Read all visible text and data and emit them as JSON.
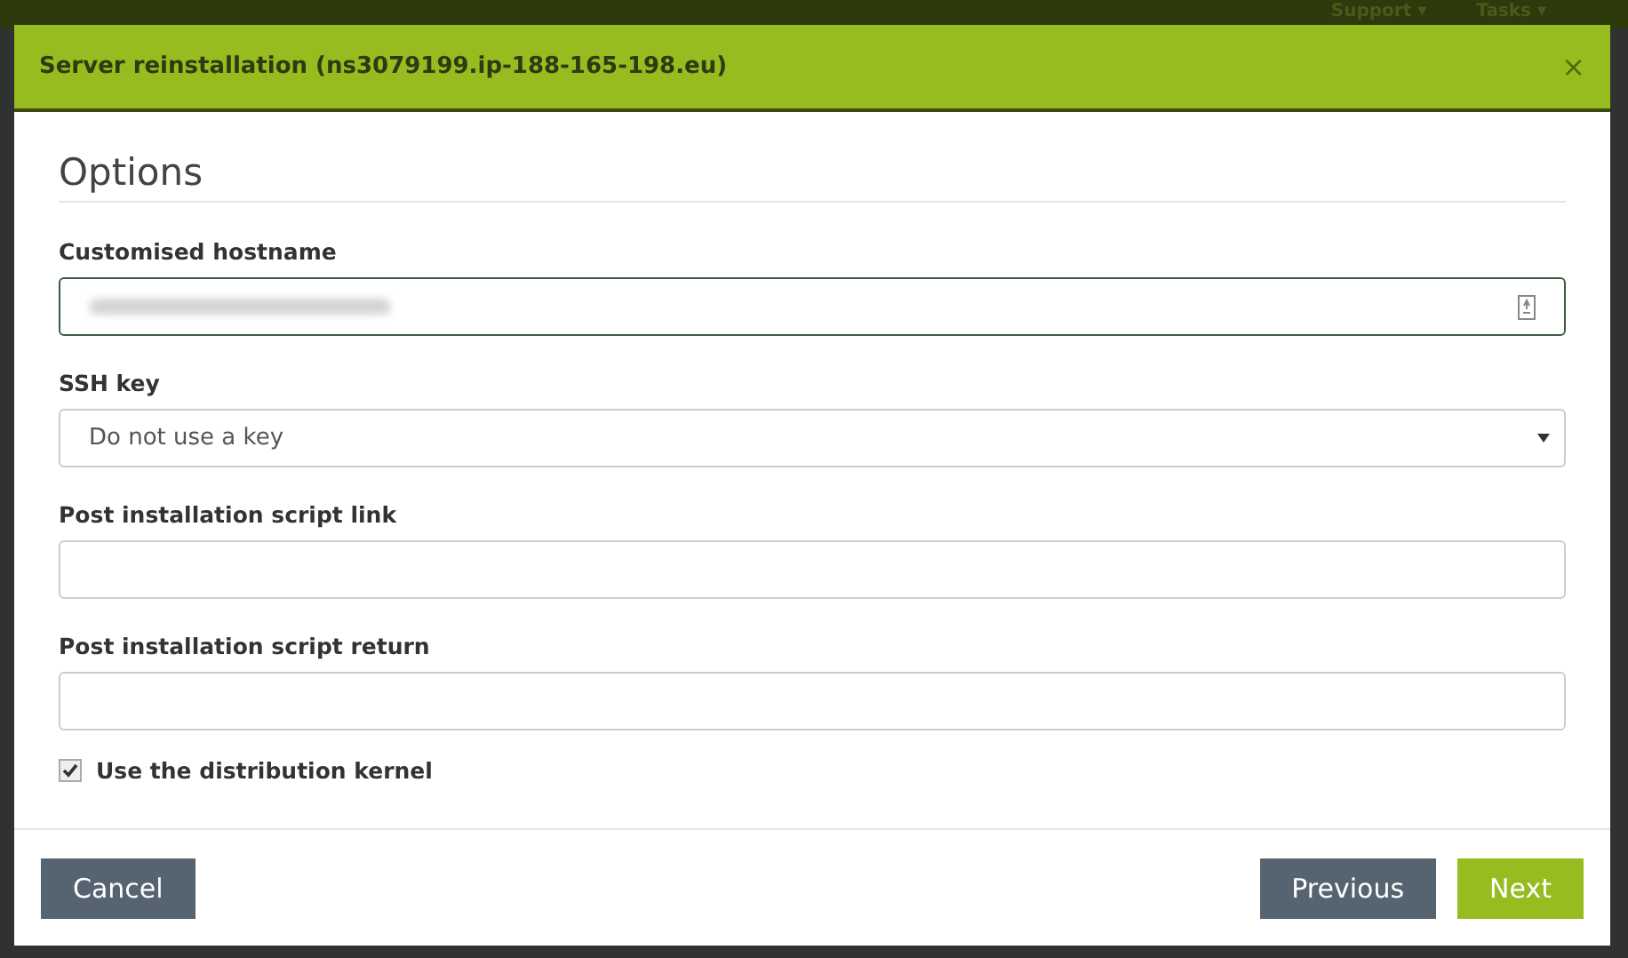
{
  "background_nav": {
    "items": [
      {
        "label": "Support",
        "caret": "▾"
      },
      {
        "label": "Tasks",
        "caret": "▾"
      }
    ]
  },
  "dialog": {
    "title": "Server reinstallation (ns3079199.ip-188-165-198.eu)",
    "close": "×",
    "section": "Options",
    "fields": [
      {
        "kind": "text",
        "label": "Customised hostname",
        "focused": true,
        "value_blurred": true
      },
      {
        "kind": "select",
        "label": "SSH key",
        "value": "Do not use a key"
      },
      {
        "kind": "text",
        "label": "Post installation script link",
        "focused": false
      },
      {
        "kind": "text",
        "label": "Post installation script return",
        "focused": false
      }
    ],
    "checkbox": {
      "label": "Use the distribution kernel",
      "checked": true
    },
    "buttons": [
      {
        "kind": "secondary",
        "label": "Cancel"
      },
      {
        "kind": "secondary",
        "label": "Previous"
      },
      {
        "kind": "primary",
        "label": "Next"
      }
    ]
  }
}
